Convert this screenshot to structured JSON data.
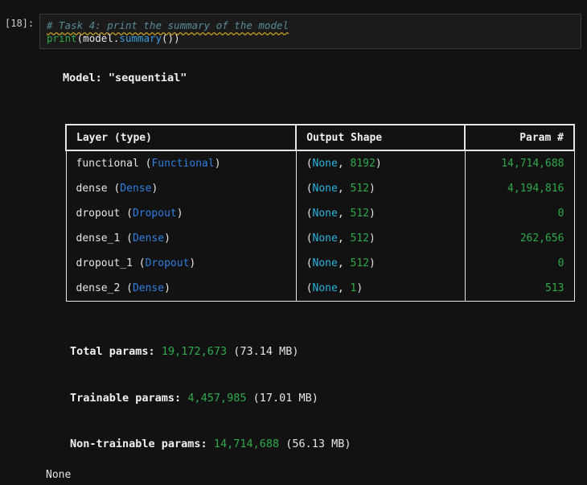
{
  "cell": {
    "prompt": "[18]:",
    "comment": "# Task 4: print the summary of the model",
    "code": {
      "func": "print",
      "open": "(",
      "obj": "model",
      "dot": ".",
      "method": "summary",
      "close": "())"
    }
  },
  "output": {
    "model_title": "Model: \"sequential\"",
    "table": {
      "headers": [
        "Layer (type)",
        "Output Shape",
        "Param #"
      ],
      "rows": [
        {
          "name": "functional",
          "type": "Functional",
          "dim": "8192",
          "params": "14,714,688"
        },
        {
          "name": "dense",
          "type": "Dense",
          "dim": "512",
          "params": "4,194,816"
        },
        {
          "name": "dropout",
          "type": "Dropout",
          "dim": "512",
          "params": "0"
        },
        {
          "name": "dense_1",
          "type": "Dense",
          "dim": "512",
          "params": "262,656"
        },
        {
          "name": "dropout_1",
          "type": "Dropout",
          "dim": "512",
          "params": "0"
        },
        {
          "name": "dense_2",
          "type": "Dense",
          "dim": "1",
          "params": "513"
        }
      ],
      "none_token": "None"
    },
    "total": {
      "label": "Total params:",
      "value": "19,172,673",
      "size": "(73.14 MB)"
    },
    "trainable": {
      "label": "Trainable params:",
      "value": "4,457,985",
      "size": "(17.01 MB)"
    },
    "non_trainable": {
      "label": "Non-trainable params:",
      "value": "14,714,688",
      "size": "(56.13 MB)"
    },
    "return_value": "None"
  },
  "colors": {
    "background": "#121212",
    "green": "#2eaa4b",
    "type_blue": "#2f7fe0",
    "none_blue": "#2ab3e0"
  }
}
